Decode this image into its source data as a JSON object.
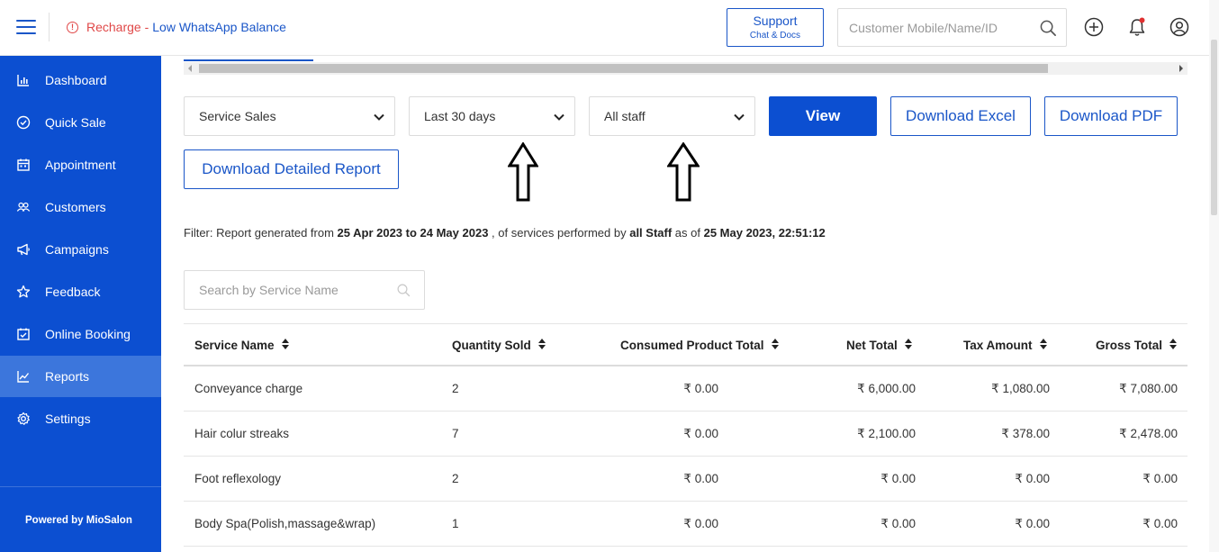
{
  "topbar": {
    "alert_prefix": "Recharge - ",
    "alert_link": "Low WhatsApp Balance",
    "support_label": "Support",
    "support_sub": "Chat & Docs",
    "search_placeholder": "Customer Mobile/Name/ID",
    "icons": [
      "menu-icon",
      "info-icon",
      "search-icon",
      "add-icon",
      "bell-icon",
      "user-icon"
    ]
  },
  "sidebar": {
    "items": [
      {
        "label": "Dashboard",
        "icon": "bar-chart-icon"
      },
      {
        "label": "Quick Sale",
        "icon": "check-circle-icon"
      },
      {
        "label": "Appointment",
        "icon": "calendar-icon"
      },
      {
        "label": "Customers",
        "icon": "users-icon"
      },
      {
        "label": "Campaigns",
        "icon": "megaphone-icon"
      },
      {
        "label": "Feedback",
        "icon": "star-icon"
      },
      {
        "label": "Online Booking",
        "icon": "calendar-check-icon"
      },
      {
        "label": "Reports",
        "icon": "line-chart-icon"
      },
      {
        "label": "Settings",
        "icon": "gear-icon"
      }
    ],
    "active": "Reports",
    "powered_by": "Powered by MioSalon"
  },
  "filters": {
    "report_type": "Service Sales",
    "period": "Last 30 days",
    "staff": "All staff",
    "view_label": "View",
    "excel_label": "Download Excel",
    "pdf_label": "Download PDF",
    "detailed_label": "Download Detailed Report"
  },
  "filter_summary": {
    "prefix": "Filter: Report generated from ",
    "date_range": "25 Apr 2023 to 24 May 2023",
    "middle": " , of services performed by ",
    "staff": "all Staff",
    "as_of": " as of ",
    "timestamp": "25 May 2023, 22:51:12"
  },
  "service_search_placeholder": "Search by Service Name",
  "table": {
    "columns": [
      "Service Name",
      "Quantity Sold",
      "Consumed Product Total",
      "Net Total",
      "Tax Amount",
      "Gross Total"
    ],
    "rows": [
      [
        "Conveyance charge",
        "2",
        "₹ 0.00",
        "₹ 6,000.00",
        "₹ 1,080.00",
        "₹ 7,080.00"
      ],
      [
        "Hair colur streaks",
        "7",
        "₹ 0.00",
        "₹ 2,100.00",
        "₹ 378.00",
        "₹ 2,478.00"
      ],
      [
        "Foot reflexology",
        "2",
        "₹ 0.00",
        "₹ 0.00",
        "₹ 0.00",
        "₹ 0.00"
      ],
      [
        "Body Spa(Polish,massage&wrap)",
        "1",
        "₹ 0.00",
        "₹ 0.00",
        "₹ 0.00",
        "₹ 0.00"
      ]
    ]
  },
  "colors": {
    "brand": "#0c4fd1",
    "active_nav": "#3c76dc",
    "alert": "#e04848"
  }
}
